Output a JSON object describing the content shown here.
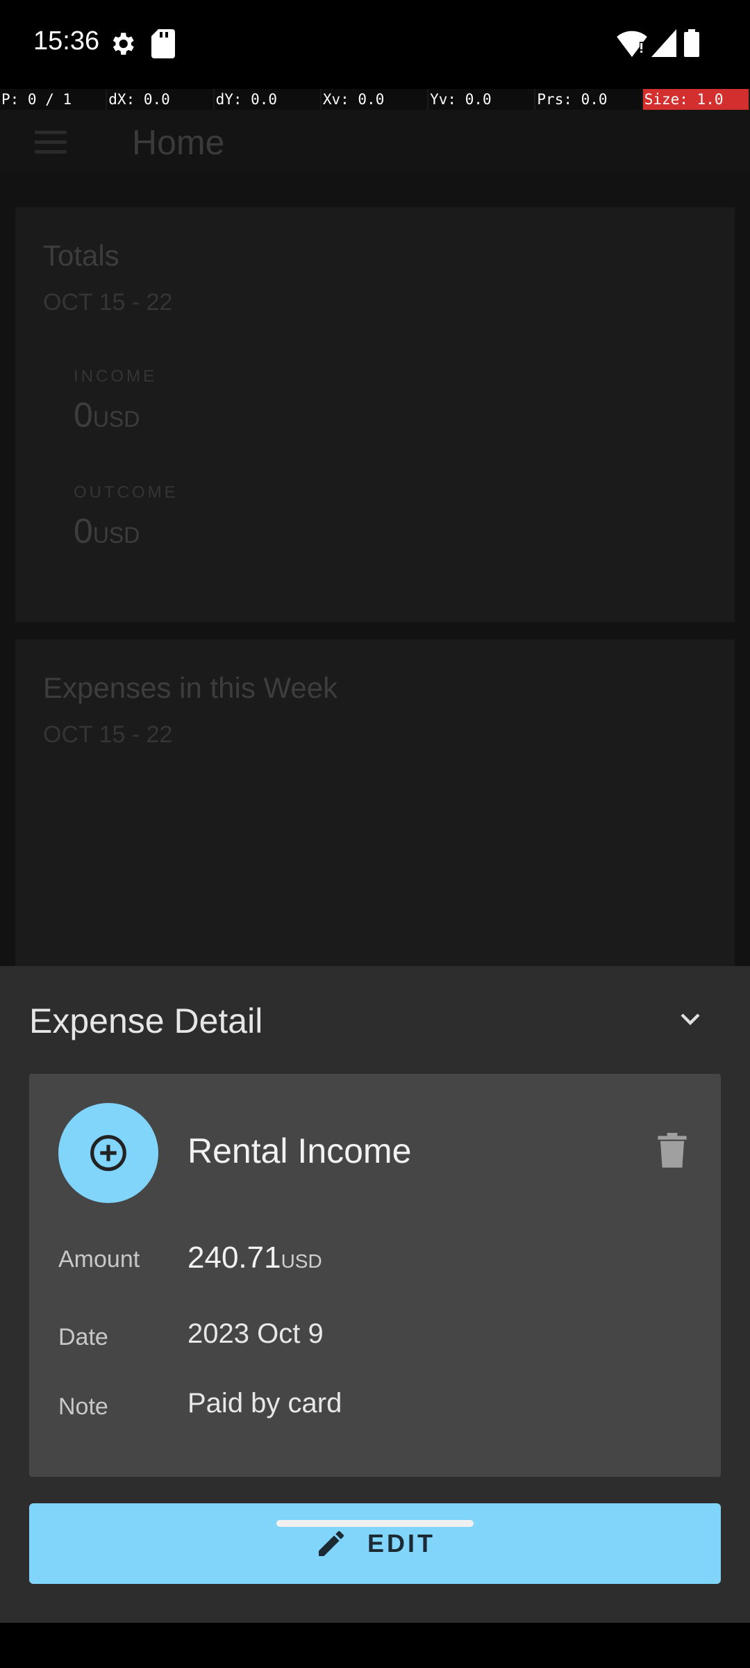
{
  "status_bar": {
    "time": "15:36"
  },
  "pointer_bar": {
    "cells": [
      "P: 0 / 1",
      "dX: 0.0",
      "dY: 0.0",
      "Xv: 0.0",
      "Yv: 0.0",
      "Prs: 0.0",
      "Size: 1.0"
    ]
  },
  "app_bar": {
    "title": "Home"
  },
  "totals_card": {
    "title": "Totals",
    "date_range": "OCT 15 - 22",
    "income_label": "INCOME",
    "income_value": "0",
    "income_currency": "USD",
    "outcome_label": "OUTCOME",
    "outcome_value": "0",
    "outcome_currency": "USD"
  },
  "expenses_card": {
    "title": "Expenses in this Week",
    "date_range": "OCT 15 - 22"
  },
  "sheet": {
    "title": "Expense Detail",
    "category_name": "Rental Income",
    "amount_label": "Amount",
    "amount_value": "240.71",
    "amount_currency": "USD",
    "date_label": "Date",
    "date_value": "2023 Oct 9",
    "note_label": "Note",
    "note_value": "Paid by card",
    "edit_label": "EDIT"
  },
  "colors": {
    "accent": "#81d4fa",
    "sheet_background": "#2d2d2d",
    "card_background": "#464646"
  }
}
